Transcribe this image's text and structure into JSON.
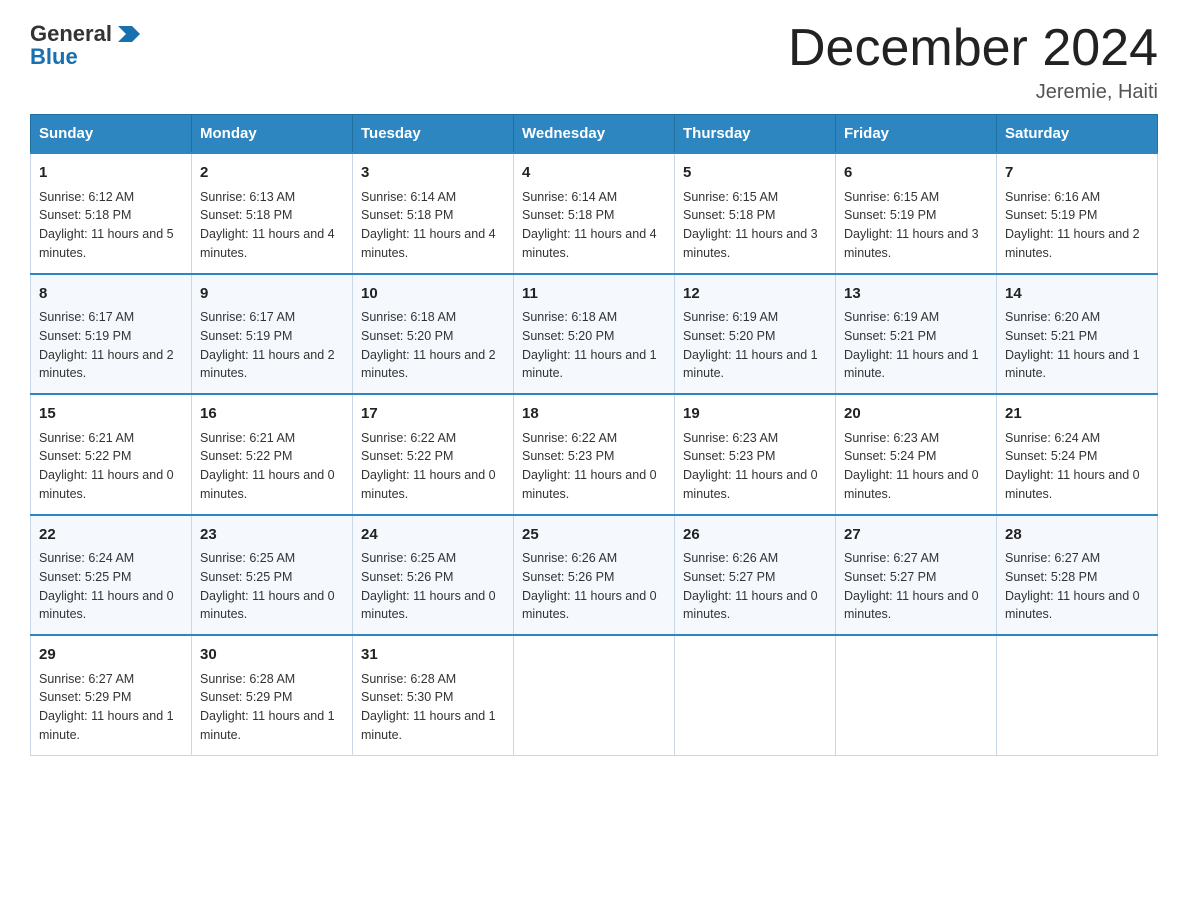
{
  "logo": {
    "text_general": "General",
    "text_blue": "Blue",
    "arrow_color": "#1a6faf"
  },
  "header": {
    "title": "December 2024",
    "location": "Jeremie, Haiti"
  },
  "days_of_week": [
    "Sunday",
    "Monday",
    "Tuesday",
    "Wednesday",
    "Thursday",
    "Friday",
    "Saturday"
  ],
  "weeks": [
    [
      {
        "day": "1",
        "sunrise": "6:12 AM",
        "sunset": "5:18 PM",
        "daylight": "11 hours and 5 minutes."
      },
      {
        "day": "2",
        "sunrise": "6:13 AM",
        "sunset": "5:18 PM",
        "daylight": "11 hours and 4 minutes."
      },
      {
        "day": "3",
        "sunrise": "6:14 AM",
        "sunset": "5:18 PM",
        "daylight": "11 hours and 4 minutes."
      },
      {
        "day": "4",
        "sunrise": "6:14 AM",
        "sunset": "5:18 PM",
        "daylight": "11 hours and 4 minutes."
      },
      {
        "day": "5",
        "sunrise": "6:15 AM",
        "sunset": "5:18 PM",
        "daylight": "11 hours and 3 minutes."
      },
      {
        "day": "6",
        "sunrise": "6:15 AM",
        "sunset": "5:19 PM",
        "daylight": "11 hours and 3 minutes."
      },
      {
        "day": "7",
        "sunrise": "6:16 AM",
        "sunset": "5:19 PM",
        "daylight": "11 hours and 2 minutes."
      }
    ],
    [
      {
        "day": "8",
        "sunrise": "6:17 AM",
        "sunset": "5:19 PM",
        "daylight": "11 hours and 2 minutes."
      },
      {
        "day": "9",
        "sunrise": "6:17 AM",
        "sunset": "5:19 PM",
        "daylight": "11 hours and 2 minutes."
      },
      {
        "day": "10",
        "sunrise": "6:18 AM",
        "sunset": "5:20 PM",
        "daylight": "11 hours and 2 minutes."
      },
      {
        "day": "11",
        "sunrise": "6:18 AM",
        "sunset": "5:20 PM",
        "daylight": "11 hours and 1 minute."
      },
      {
        "day": "12",
        "sunrise": "6:19 AM",
        "sunset": "5:20 PM",
        "daylight": "11 hours and 1 minute."
      },
      {
        "day": "13",
        "sunrise": "6:19 AM",
        "sunset": "5:21 PM",
        "daylight": "11 hours and 1 minute."
      },
      {
        "day": "14",
        "sunrise": "6:20 AM",
        "sunset": "5:21 PM",
        "daylight": "11 hours and 1 minute."
      }
    ],
    [
      {
        "day": "15",
        "sunrise": "6:21 AM",
        "sunset": "5:22 PM",
        "daylight": "11 hours and 0 minutes."
      },
      {
        "day": "16",
        "sunrise": "6:21 AM",
        "sunset": "5:22 PM",
        "daylight": "11 hours and 0 minutes."
      },
      {
        "day": "17",
        "sunrise": "6:22 AM",
        "sunset": "5:22 PM",
        "daylight": "11 hours and 0 minutes."
      },
      {
        "day": "18",
        "sunrise": "6:22 AM",
        "sunset": "5:23 PM",
        "daylight": "11 hours and 0 minutes."
      },
      {
        "day": "19",
        "sunrise": "6:23 AM",
        "sunset": "5:23 PM",
        "daylight": "11 hours and 0 minutes."
      },
      {
        "day": "20",
        "sunrise": "6:23 AM",
        "sunset": "5:24 PM",
        "daylight": "11 hours and 0 minutes."
      },
      {
        "day": "21",
        "sunrise": "6:24 AM",
        "sunset": "5:24 PM",
        "daylight": "11 hours and 0 minutes."
      }
    ],
    [
      {
        "day": "22",
        "sunrise": "6:24 AM",
        "sunset": "5:25 PM",
        "daylight": "11 hours and 0 minutes."
      },
      {
        "day": "23",
        "sunrise": "6:25 AM",
        "sunset": "5:25 PM",
        "daylight": "11 hours and 0 minutes."
      },
      {
        "day": "24",
        "sunrise": "6:25 AM",
        "sunset": "5:26 PM",
        "daylight": "11 hours and 0 minutes."
      },
      {
        "day": "25",
        "sunrise": "6:26 AM",
        "sunset": "5:26 PM",
        "daylight": "11 hours and 0 minutes."
      },
      {
        "day": "26",
        "sunrise": "6:26 AM",
        "sunset": "5:27 PM",
        "daylight": "11 hours and 0 minutes."
      },
      {
        "day": "27",
        "sunrise": "6:27 AM",
        "sunset": "5:27 PM",
        "daylight": "11 hours and 0 minutes."
      },
      {
        "day": "28",
        "sunrise": "6:27 AM",
        "sunset": "5:28 PM",
        "daylight": "11 hours and 0 minutes."
      }
    ],
    [
      {
        "day": "29",
        "sunrise": "6:27 AM",
        "sunset": "5:29 PM",
        "daylight": "11 hours and 1 minute."
      },
      {
        "day": "30",
        "sunrise": "6:28 AM",
        "sunset": "5:29 PM",
        "daylight": "11 hours and 1 minute."
      },
      {
        "day": "31",
        "sunrise": "6:28 AM",
        "sunset": "5:30 PM",
        "daylight": "11 hours and 1 minute."
      },
      null,
      null,
      null,
      null
    ]
  ],
  "labels": {
    "sunrise": "Sunrise:",
    "sunset": "Sunset:",
    "daylight": "Daylight:"
  }
}
